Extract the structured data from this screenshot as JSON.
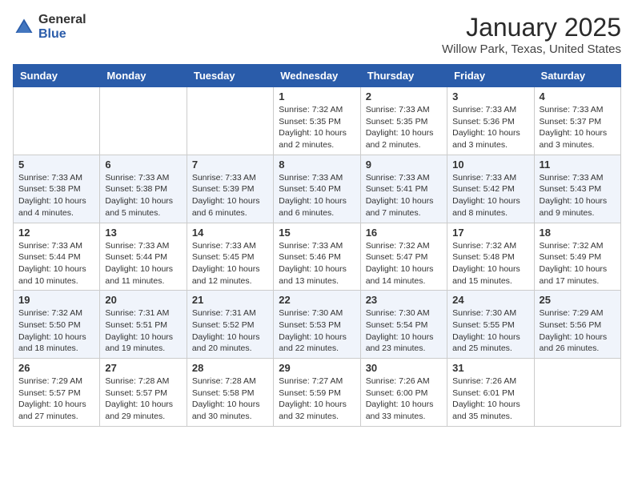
{
  "header": {
    "logo_general": "General",
    "logo_blue": "Blue",
    "title": "January 2025",
    "subtitle": "Willow Park, Texas, United States"
  },
  "calendar": {
    "days_of_week": [
      "Sunday",
      "Monday",
      "Tuesday",
      "Wednesday",
      "Thursday",
      "Friday",
      "Saturday"
    ],
    "weeks": [
      [
        {
          "day": "",
          "info": ""
        },
        {
          "day": "",
          "info": ""
        },
        {
          "day": "",
          "info": ""
        },
        {
          "day": "1",
          "info": "Sunrise: 7:32 AM\nSunset: 5:35 PM\nDaylight: 10 hours\nand 2 minutes."
        },
        {
          "day": "2",
          "info": "Sunrise: 7:33 AM\nSunset: 5:35 PM\nDaylight: 10 hours\nand 2 minutes."
        },
        {
          "day": "3",
          "info": "Sunrise: 7:33 AM\nSunset: 5:36 PM\nDaylight: 10 hours\nand 3 minutes."
        },
        {
          "day": "4",
          "info": "Sunrise: 7:33 AM\nSunset: 5:37 PM\nDaylight: 10 hours\nand 3 minutes."
        }
      ],
      [
        {
          "day": "5",
          "info": "Sunrise: 7:33 AM\nSunset: 5:38 PM\nDaylight: 10 hours\nand 4 minutes."
        },
        {
          "day": "6",
          "info": "Sunrise: 7:33 AM\nSunset: 5:38 PM\nDaylight: 10 hours\nand 5 minutes."
        },
        {
          "day": "7",
          "info": "Sunrise: 7:33 AM\nSunset: 5:39 PM\nDaylight: 10 hours\nand 6 minutes."
        },
        {
          "day": "8",
          "info": "Sunrise: 7:33 AM\nSunset: 5:40 PM\nDaylight: 10 hours\nand 6 minutes."
        },
        {
          "day": "9",
          "info": "Sunrise: 7:33 AM\nSunset: 5:41 PM\nDaylight: 10 hours\nand 7 minutes."
        },
        {
          "day": "10",
          "info": "Sunrise: 7:33 AM\nSunset: 5:42 PM\nDaylight: 10 hours\nand 8 minutes."
        },
        {
          "day": "11",
          "info": "Sunrise: 7:33 AM\nSunset: 5:43 PM\nDaylight: 10 hours\nand 9 minutes."
        }
      ],
      [
        {
          "day": "12",
          "info": "Sunrise: 7:33 AM\nSunset: 5:44 PM\nDaylight: 10 hours\nand 10 minutes."
        },
        {
          "day": "13",
          "info": "Sunrise: 7:33 AM\nSunset: 5:44 PM\nDaylight: 10 hours\nand 11 minutes."
        },
        {
          "day": "14",
          "info": "Sunrise: 7:33 AM\nSunset: 5:45 PM\nDaylight: 10 hours\nand 12 minutes."
        },
        {
          "day": "15",
          "info": "Sunrise: 7:33 AM\nSunset: 5:46 PM\nDaylight: 10 hours\nand 13 minutes."
        },
        {
          "day": "16",
          "info": "Sunrise: 7:32 AM\nSunset: 5:47 PM\nDaylight: 10 hours\nand 14 minutes."
        },
        {
          "day": "17",
          "info": "Sunrise: 7:32 AM\nSunset: 5:48 PM\nDaylight: 10 hours\nand 15 minutes."
        },
        {
          "day": "18",
          "info": "Sunrise: 7:32 AM\nSunset: 5:49 PM\nDaylight: 10 hours\nand 17 minutes."
        }
      ],
      [
        {
          "day": "19",
          "info": "Sunrise: 7:32 AM\nSunset: 5:50 PM\nDaylight: 10 hours\nand 18 minutes."
        },
        {
          "day": "20",
          "info": "Sunrise: 7:31 AM\nSunset: 5:51 PM\nDaylight: 10 hours\nand 19 minutes."
        },
        {
          "day": "21",
          "info": "Sunrise: 7:31 AM\nSunset: 5:52 PM\nDaylight: 10 hours\nand 20 minutes."
        },
        {
          "day": "22",
          "info": "Sunrise: 7:30 AM\nSunset: 5:53 PM\nDaylight: 10 hours\nand 22 minutes."
        },
        {
          "day": "23",
          "info": "Sunrise: 7:30 AM\nSunset: 5:54 PM\nDaylight: 10 hours\nand 23 minutes."
        },
        {
          "day": "24",
          "info": "Sunrise: 7:30 AM\nSunset: 5:55 PM\nDaylight: 10 hours\nand 25 minutes."
        },
        {
          "day": "25",
          "info": "Sunrise: 7:29 AM\nSunset: 5:56 PM\nDaylight: 10 hours\nand 26 minutes."
        }
      ],
      [
        {
          "day": "26",
          "info": "Sunrise: 7:29 AM\nSunset: 5:57 PM\nDaylight: 10 hours\nand 27 minutes."
        },
        {
          "day": "27",
          "info": "Sunrise: 7:28 AM\nSunset: 5:57 PM\nDaylight: 10 hours\nand 29 minutes."
        },
        {
          "day": "28",
          "info": "Sunrise: 7:28 AM\nSunset: 5:58 PM\nDaylight: 10 hours\nand 30 minutes."
        },
        {
          "day": "29",
          "info": "Sunrise: 7:27 AM\nSunset: 5:59 PM\nDaylight: 10 hours\nand 32 minutes."
        },
        {
          "day": "30",
          "info": "Sunrise: 7:26 AM\nSunset: 6:00 PM\nDaylight: 10 hours\nand 33 minutes."
        },
        {
          "day": "31",
          "info": "Sunrise: 7:26 AM\nSunset: 6:01 PM\nDaylight: 10 hours\nand 35 minutes."
        },
        {
          "day": "",
          "info": ""
        }
      ]
    ]
  }
}
